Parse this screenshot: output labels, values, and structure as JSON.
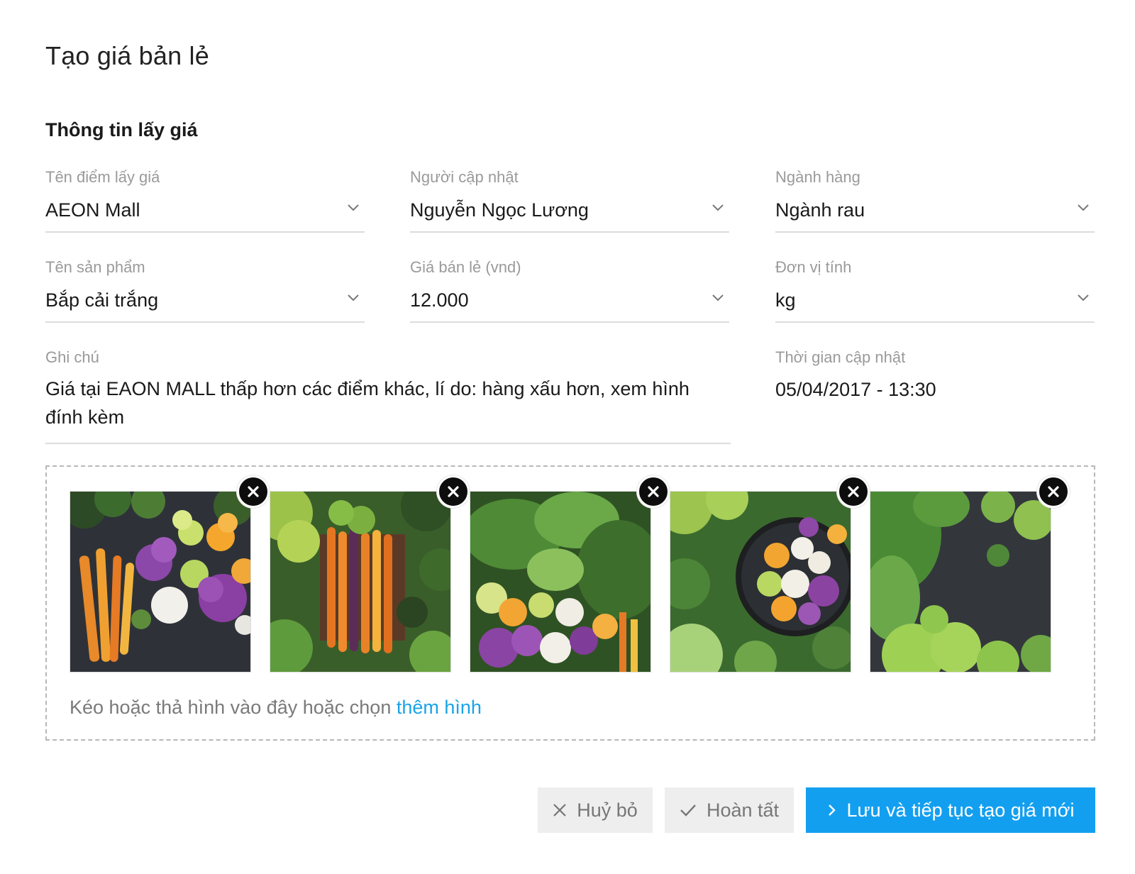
{
  "page": {
    "title": "Tạo giá bản lẻ"
  },
  "section": {
    "title": "Thông tin lấy giá"
  },
  "fields": {
    "location": {
      "label": "Tên điểm lấy giá",
      "value": "AEON Mall"
    },
    "updater": {
      "label": "Người cập nhật",
      "value": "Nguyễn Ngọc Lương"
    },
    "category": {
      "label": "Ngành hàng",
      "value": "Ngành rau"
    },
    "product": {
      "label": "Tên sản phẩm",
      "value": "Bắp cải trắng"
    },
    "price": {
      "label": "Giá bán lẻ (vnd)",
      "value": "12.000"
    },
    "unit": {
      "label": "Đơn vị tính",
      "value": "kg"
    },
    "note": {
      "label": "Ghi chú",
      "value": "Giá tại EAON MALL thấp hơn các điểm khác, lí do: hàng xấu hơn, xem hình đính kèm"
    },
    "updated_time": {
      "label": "Thời gian cập nhật",
      "value": "05/04/2017 - 13:30"
    }
  },
  "dropzone": {
    "hint": "Kéo hoặc thả hình vào đây hoặc chọn",
    "link": "thêm hình",
    "images": [
      {
        "icon": "vegetable-photo-1"
      },
      {
        "icon": "vegetable-photo-2"
      },
      {
        "icon": "vegetable-photo-3"
      },
      {
        "icon": "vegetable-photo-4"
      },
      {
        "icon": "vegetable-photo-5"
      }
    ]
  },
  "actions": {
    "cancel_label": "Huỷ bỏ",
    "done_label": "Hoàn tất",
    "save_label": "Lưu và tiếp tục tạo giá mới"
  },
  "colors": {
    "primary": "#139ff0",
    "link": "#1aa3e8",
    "secondary_button": "#eeeeee"
  }
}
